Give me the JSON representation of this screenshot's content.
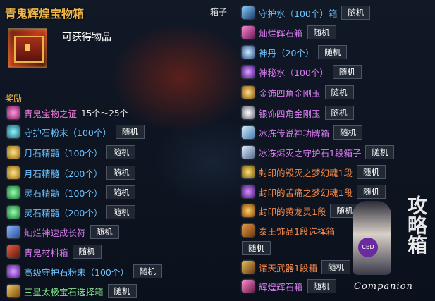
{
  "header": {
    "title": "青鬼辉煌宝物箱",
    "box_type": "箱子",
    "obtain_label": "可获得物品",
    "reward_label": "奖励"
  },
  "colors": {
    "title_gold": "#f0b84a",
    "purple": "#d97cf0",
    "pink": "#f07cd8",
    "blue": "#6ec3ff",
    "green": "#7fe38a",
    "orange": "#f58a4a"
  },
  "left_items": [
    {
      "name": "青鬼宝物之证",
      "qty": "15个～25个",
      "tag": "",
      "icon": "token-icon"
    },
    {
      "name": "守护石粉末（100个）",
      "qty": "",
      "tag": "随机",
      "icon": "guardian-powder-icon"
    },
    {
      "name": "月石精髓（100个）",
      "qty": "",
      "tag": "随机",
      "icon": "moonstone-icon"
    },
    {
      "name": "月石精髓（200个）",
      "qty": "",
      "tag": "随机",
      "icon": "moonstone-icon"
    },
    {
      "name": "灵石精髓（100个）",
      "qty": "",
      "tag": "随机",
      "icon": "spiritstone-icon"
    },
    {
      "name": "灵石精髓（200个）",
      "qty": "",
      "tag": "随机",
      "icon": "spiritstone-icon"
    },
    {
      "name": "灿烂神速成长符",
      "qty": "",
      "tag": "随机",
      "icon": "growth-charm-icon"
    },
    {
      "name": "青鬼材料箱",
      "qty": "",
      "tag": "随机",
      "icon": "material-box-icon"
    },
    {
      "name": "高级守护石粉末（100个）",
      "qty": "",
      "tag": "随机",
      "icon": "advanced-powder-icon"
    },
    {
      "name": "三星太极宝石选择箱",
      "qty": "",
      "tag": "随机",
      "icon": "gem-selection-box-icon"
    }
  ],
  "right_items": [
    {
      "name": "守护水（100个）箱",
      "tag": "随机",
      "icon": "guardian-water-box-icon"
    },
    {
      "name": "灿烂辉石箱",
      "tag": "随机",
      "icon": "radiant-stone-box-icon"
    },
    {
      "name": "神丹（20个）",
      "tag": "随机",
      "icon": "elixir-icon"
    },
    {
      "name": "神秘水（100个）",
      "tag": "随机",
      "icon": "mystic-water-icon"
    },
    {
      "name": "金饰四角金刚玉",
      "tag": "随机",
      "icon": "gold-diamond-icon"
    },
    {
      "name": "银饰四角金刚玉",
      "tag": "随机",
      "icon": "silver-diamond-icon"
    },
    {
      "name": "冰冻传说神功牌箱",
      "tag": "随机",
      "icon": "frozen-card-box-icon"
    },
    {
      "name": "冰冻烬灭之守护石1段箱子",
      "tag": "随机",
      "icon": "frozen-guardian-box-icon"
    },
    {
      "name": "封印的毁灭之梦幻魂1段",
      "tag": "随机",
      "icon": "sealed-soul-icon"
    },
    {
      "name": "封印的苦痛之梦幻魂1段",
      "tag": "随机",
      "icon": "sealed-soul-icon"
    },
    {
      "name": "封印的黄龙灵1段",
      "tag": "随机",
      "icon": "sealed-dragon-icon"
    },
    {
      "name": "泰王饰品1段选择箱",
      "tag": "随机",
      "icon": "accessory-box-icon"
    },
    {
      "name": "诸天武器1段箱",
      "tag": "随机",
      "icon": "weapon-box-icon"
    },
    {
      "name": "辉煌辉石箱",
      "tag": "随机",
      "icon": "brilliant-stone-box-icon"
    }
  ],
  "watermark": {
    "text": "Companion",
    "brush_text": "攻略箱",
    "badge": "CBD"
  }
}
